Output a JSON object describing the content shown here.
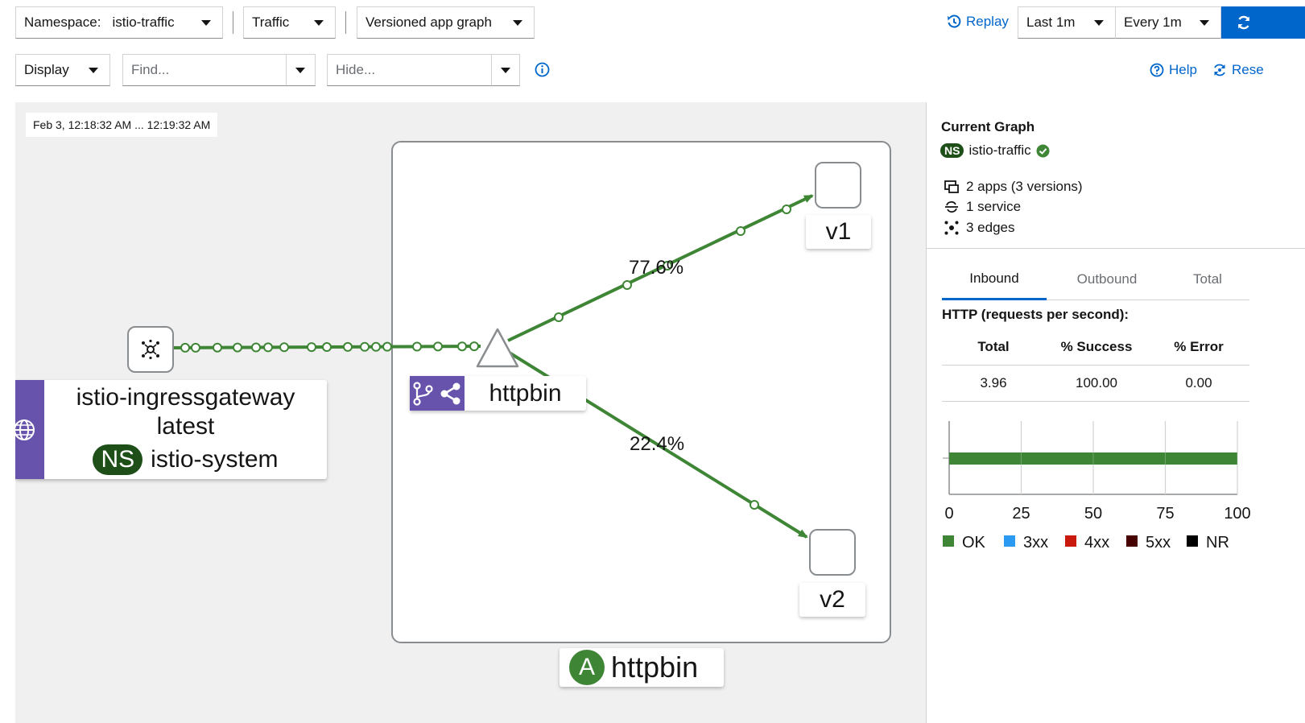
{
  "toolbar": {
    "namespace_label": "Namespace:",
    "namespace_value": "istio-traffic",
    "traffic_label": "Traffic",
    "graph_type": "Versioned app graph",
    "replay_label": "Replay",
    "duration": "Last 1m",
    "refresh_interval": "Every 1m",
    "display_label": "Display",
    "find_placeholder": "Find...",
    "hide_placeholder": "Hide...",
    "help_label": "Help",
    "reset_label": "Rese"
  },
  "graph": {
    "timestamp": "Feb 3, 12:18:32 AM ... 12:19:32 AM",
    "gateway": {
      "name": "istio-ingressgateway",
      "version": "latest",
      "ns_badge": "NS",
      "namespace": "istio-system"
    },
    "service_label": "httpbin",
    "v1_label": "v1",
    "v2_label": "v2",
    "edge_v1_pct": "77.6%",
    "edge_v2_pct": "22.4%",
    "app_badge": "A",
    "app_label": "httpbin",
    "edge_color": "#3e8635",
    "gateway_accent": "#6753ac"
  },
  "side": {
    "title": "Current Graph",
    "ns_badge": "NS",
    "namespace": "istio-traffic",
    "apps": "2 apps (3 versions)",
    "services": "1 service",
    "edges": "3 edges",
    "tabs": [
      "Inbound",
      "Outbound",
      "Total"
    ],
    "http_title": "HTTP (requests per second):",
    "table": {
      "headers": [
        "Total",
        "% Success",
        "% Error"
      ],
      "row": [
        "3.96",
        "100.00",
        "0.00"
      ]
    }
  },
  "chart_data": {
    "type": "bar",
    "orientation": "horizontal",
    "series": [
      {
        "name": "OK",
        "values": [
          100
        ],
        "color": "#3e8635"
      },
      {
        "name": "3xx",
        "values": [
          0
        ],
        "color": "#2b9af3"
      },
      {
        "name": "4xx",
        "values": [
          0
        ],
        "color": "#c9190b"
      },
      {
        "name": "5xx",
        "values": [
          0
        ],
        "color": "#470000"
      },
      {
        "name": "NR",
        "values": [
          0
        ],
        "color": "#000000"
      }
    ],
    "xlim": [
      0,
      100
    ],
    "ticks": [
      "0",
      "25",
      "50",
      "75",
      "100"
    ],
    "grid": true,
    "legend": "bottom"
  }
}
